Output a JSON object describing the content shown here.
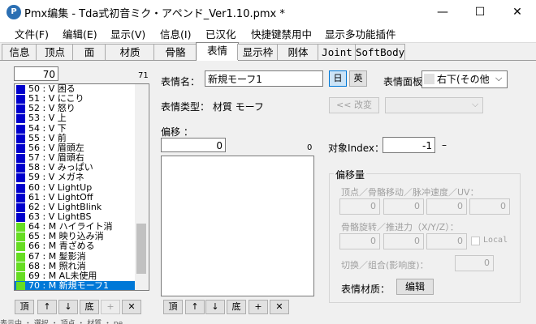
{
  "window": {
    "title": "Pmx编集 - Tda式初音ミク・アペンド_Ver1.10.pmx *",
    "minimize": "—",
    "maximize": "☐",
    "close": "✕"
  },
  "menu": [
    "文件(F)",
    "编辑(E)",
    "显示(V)",
    "信息(I)",
    "已汉化",
    "快捷键禁用中",
    "显示多功能插件"
  ],
  "tabs": [
    "信息",
    "顶点",
    "面",
    "材质",
    "骨骼",
    "表情",
    "显示枠",
    "刚体",
    "Joint",
    "SoftBody"
  ],
  "left": {
    "count_input": "70",
    "count_total": "71",
    "rows": [
      {
        "text": "50 : V  困る",
        "color": "#0000cc"
      },
      {
        "text": "51 : V  にこり",
        "color": "#0000cc"
      },
      {
        "text": "52 : V  怒り",
        "color": "#0000cc"
      },
      {
        "text": "53 : V  上",
        "color": "#0000cc"
      },
      {
        "text": "54 : V  下",
        "color": "#0000cc"
      },
      {
        "text": "55 : V  前",
        "color": "#0000cc"
      },
      {
        "text": "56 : V  眉頭左",
        "color": "#0000cc"
      },
      {
        "text": "57 : V  眉頭右",
        "color": "#0000cc"
      },
      {
        "text": "58 : V  みっぱい",
        "color": "#0000cc"
      },
      {
        "text": "59 : V  メガネ",
        "color": "#0000cc"
      },
      {
        "text": "60 : V  LightUp",
        "color": "#0000cc"
      },
      {
        "text": "61 : V  LightOff",
        "color": "#0000cc"
      },
      {
        "text": "62 : V  LightBlink",
        "color": "#0000cc"
      },
      {
        "text": "63 : V  LightBS",
        "color": "#0000cc"
      },
      {
        "text": "64 : M  ハイライト消",
        "color": "#66dd22"
      },
      {
        "text": "65 : M  映り込み消",
        "color": "#66dd22"
      },
      {
        "text": "66 : M  青ざめる",
        "color": "#66dd22"
      },
      {
        "text": "67 : M  髪影消",
        "color": "#66dd22"
      },
      {
        "text": "68 : M  照れ消",
        "color": "#66dd22"
      },
      {
        "text": "69 : M  AL未使用",
        "color": "#66dd22"
      },
      {
        "text": "70 : M  新規モーフ1",
        "color": "#66dd22"
      }
    ],
    "buttons": [
      "頂",
      "↑",
      "↓",
      "底",
      "+",
      "✕"
    ]
  },
  "middle": {
    "name_label": "表情名：",
    "name_value": "新規モーフ1",
    "jp_btn": "日",
    "en_btn": "英",
    "type_label": "表情类型：  材質 モーフ",
    "offset_label": "偏移 ：",
    "offset_input": "0",
    "offset_total": "0",
    "buttons": [
      "頂",
      "↑",
      "↓",
      "底",
      "+",
      "✕"
    ]
  },
  "right": {
    "panel_label": "表情面板",
    "panel_value": "右下(その他",
    "change_btn": "<< 改変",
    "index_label": "对象Index：",
    "index_value": "-1",
    "index_dash": "–",
    "group_label": "偏移量",
    "vertex_label": "顶点／骨骼移动／脉冲速度／UV：",
    "bone_label": "骨骼旋转／推进力（X/Y/Z）：",
    "local_label": "Local",
    "switch_label": "切换／组合(影响度)：",
    "material_label": "表情材质：",
    "edit_btn": "编辑",
    "row1": [
      "0",
      "0",
      "0",
      "0"
    ],
    "row2": [
      "0",
      "0",
      "0"
    ],
    "switch_value": "0"
  },
  "statusbar": "表示中 ・ 選択 ・ 頂点 ・ 材質 ・ pe"
}
